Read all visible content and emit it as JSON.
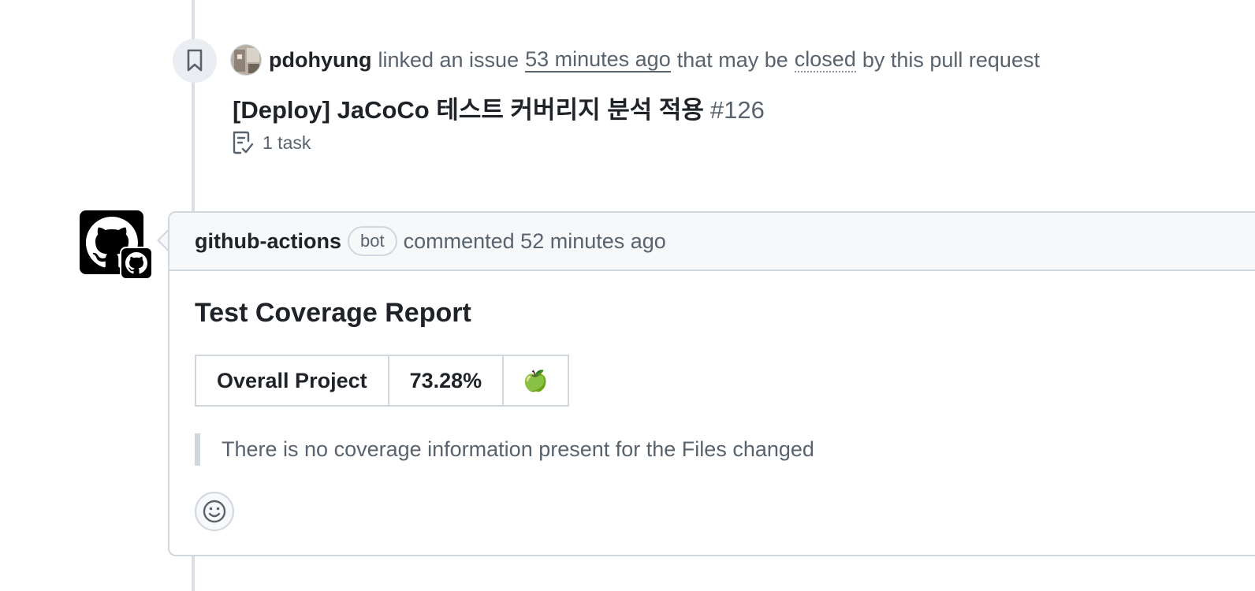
{
  "linked_event": {
    "actor": "pdohyung",
    "action_text": "linked an issue",
    "time": "53 minutes ago",
    "middle_text": "that may be",
    "closed_word": "closed",
    "end_text": "by this pull request",
    "issue_title": "[Deploy] JaCoCo 테스트 커버리지 분석 적용",
    "issue_number": "#126",
    "task_count": "1 task"
  },
  "comment": {
    "author": "github-actions",
    "badge": "bot",
    "action_text": "commented",
    "time": "52 minutes ago",
    "heading": "Test Coverage Report",
    "table": {
      "label": "Overall Project",
      "percentage": "73.28%",
      "status_emoji": "🍏"
    },
    "quote": "There is no coverage information present for the Files changed"
  },
  "icons": {
    "event": "bookmark-icon",
    "task": "task-list-icon",
    "reaction": "smiley-icon",
    "bot_avatar": "github-mark-icon"
  },
  "colors": {
    "text_primary": "#1f2328",
    "text_muted": "#59636e",
    "border": "#d0d7de",
    "header_bg": "#f6f8fa"
  }
}
